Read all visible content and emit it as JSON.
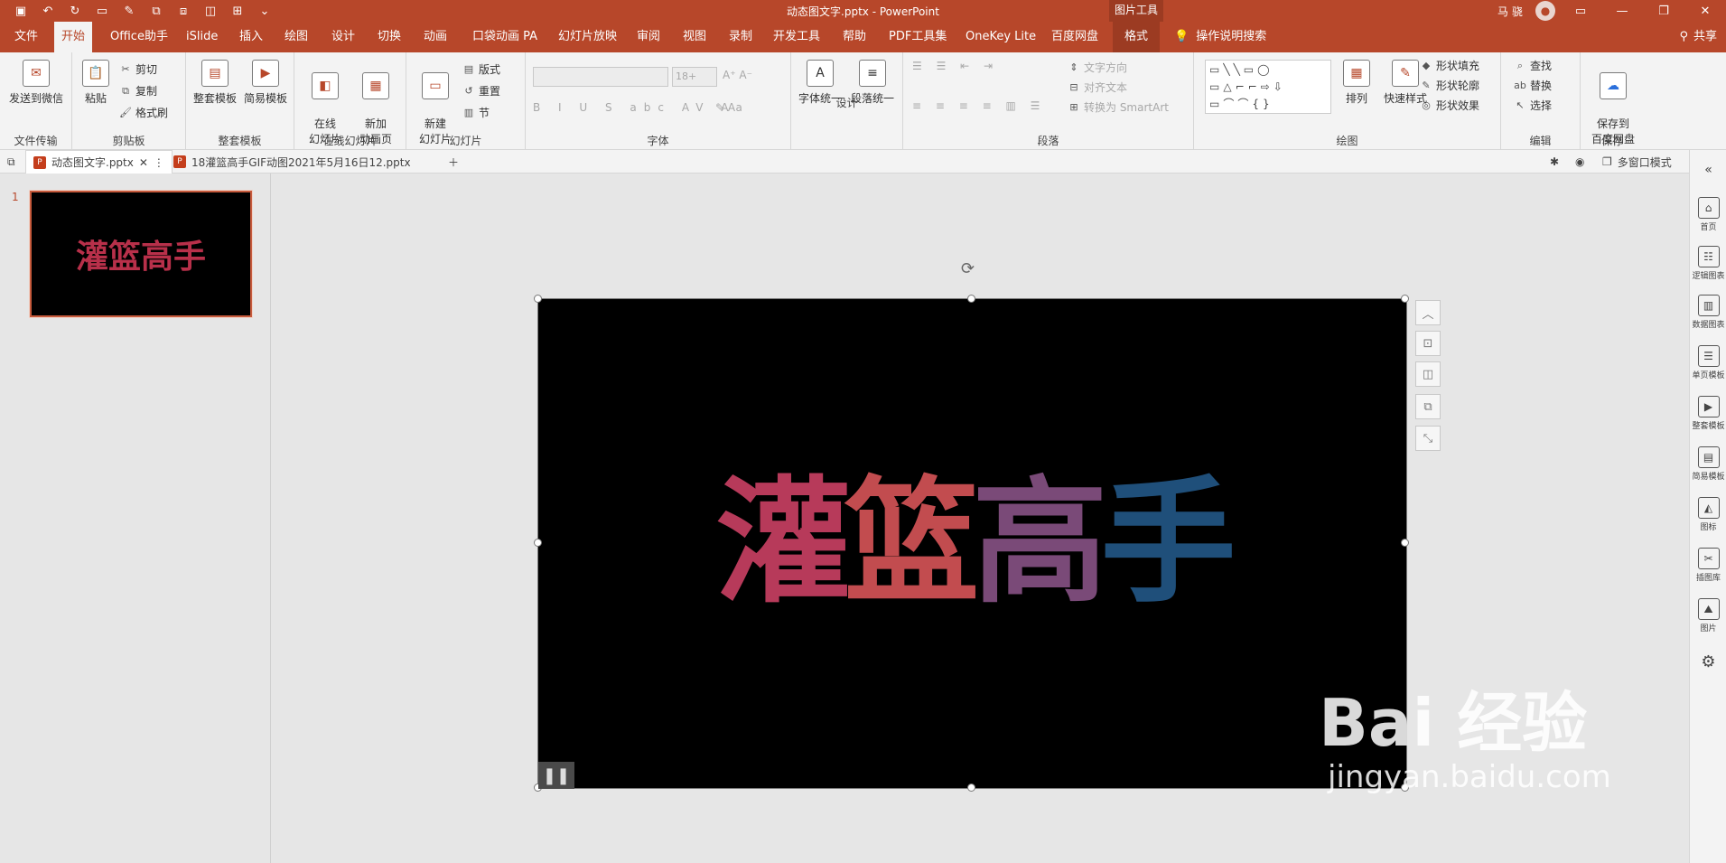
{
  "window": {
    "title": "动态图文字.pptx  -  PowerPoint",
    "context_tab_group": "图片工具",
    "user_name": "马 骁",
    "avatar_icon": "user-avatar-icon",
    "qat_icons": [
      "save-icon",
      "undo-icon",
      "redo-icon",
      "start-from-beginning-icon",
      "format-painter-icon",
      "group-icon",
      "ungroup-icon",
      "bring-forward-icon",
      "align-icon",
      "qat-more-icon"
    ]
  },
  "tabs": [
    "文件",
    "开始",
    "Office助手",
    "iSlide",
    "插入",
    "绘图",
    "设计",
    "切换",
    "动画",
    "口袋动画 PA",
    "幻灯片放映",
    "审阅",
    "视图",
    "录制",
    "开发工具",
    "帮助",
    "PDF工具集",
    "OneKey Lite",
    "百度网盘",
    "格式"
  ],
  "active_tab": "开始",
  "search_label": "操作说明搜索",
  "share_label": "共享",
  "ribbon": {
    "file_transfer": {
      "label": "文件传输",
      "send_wechat": "发送到微信"
    },
    "clipboard": {
      "label": "剪贴板",
      "paste": "粘贴",
      "cut": "剪切",
      "copy": "复制",
      "format_painter": "格式刷"
    },
    "templates": {
      "label": "整套模板",
      "full": "整套模板",
      "simple": "简易模板"
    },
    "online_slides": {
      "label": "在线幻灯片",
      "online": "在线\n幻灯片",
      "new_anim": "新加\n动画页"
    },
    "slides": {
      "label": "幻灯片",
      "new_slide": "新建\n幻灯片",
      "layout": "版式",
      "reset": "重置",
      "section": "节"
    },
    "font": {
      "label": "字体",
      "size_placeholder": "18+"
    },
    "design": {
      "label": "设计",
      "font_unify": "字体统一",
      "para_unify": "段落统一"
    },
    "paragraph": {
      "label": "段落",
      "text_direction": "文字方向",
      "align_text": "对齐文本",
      "smartart": "转换为 SmartArt"
    },
    "drawing": {
      "label": "绘图",
      "arrange": "排列",
      "quick_styles": "快速样式",
      "shape_fill": "形状填充",
      "shape_outline": "形状轮廓",
      "shape_effects": "形状效果"
    },
    "editing": {
      "label": "编辑",
      "find": "查找",
      "replace": "替换",
      "select": "选择"
    },
    "save": {
      "label": "保存",
      "save_baidu": "保存到\n百度网盘"
    }
  },
  "doc_tabs": [
    {
      "name": "动态图文字.pptx",
      "active": true
    },
    {
      "name": "18灌篮高手GIF动图2021年5月16日12.pptx",
      "active": false
    }
  ],
  "doc_toolbar": {
    "multi_window": "多窗口模式"
  },
  "thumbnails": [
    {
      "number": "1",
      "text": "灌篮高手"
    }
  ],
  "slide": {
    "text": "灌篮高手",
    "chars": [
      "灌",
      "篮",
      "高",
      "手"
    ],
    "char_colors": [
      "#b73a5a",
      "#c24c4f",
      "#7a4a78",
      "#1f4f7a"
    ]
  },
  "right_pane": [
    {
      "label": "首页",
      "icon": "home-icon"
    },
    {
      "label": "逻辑图表",
      "icon": "logic-chart-icon"
    },
    {
      "label": "数据图表",
      "icon": "data-chart-icon"
    },
    {
      "label": "单页模板",
      "icon": "single-page-template-icon"
    },
    {
      "label": "整套模板",
      "icon": "full-template-icon"
    },
    {
      "label": "简易模板",
      "icon": "simple-template-icon"
    },
    {
      "label": "图标",
      "icon": "icon-library-icon"
    },
    {
      "label": "插图库",
      "icon": "illustration-library-icon"
    },
    {
      "label": "图片",
      "icon": "picture-icon"
    },
    {
      "label": "",
      "icon": "settings-gear-icon"
    }
  ],
  "watermark": {
    "line1": "Bai 经验",
    "line2": "jingyan.baidu.com"
  }
}
